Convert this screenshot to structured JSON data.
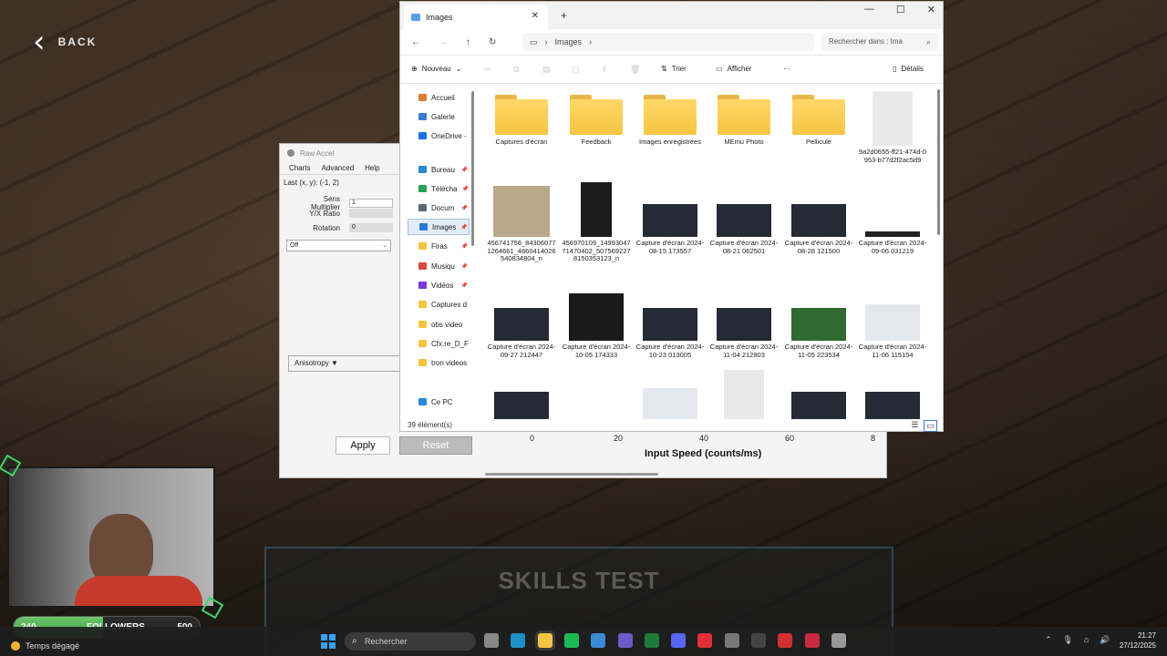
{
  "game": {
    "back_label": "BACK",
    "skills_test_label": "SKILLS TEST"
  },
  "rawaccel": {
    "title": "Raw Accel",
    "menu": [
      "Charts",
      "Advanced",
      "Help"
    ],
    "last_xy": "Last (x, y): (-1, 2)",
    "rows": [
      {
        "label": "Sens Multiplier",
        "value": "1"
      },
      {
        "label": "Y/X Ratio",
        "value": ""
      },
      {
        "label": "Rotation",
        "value": "0"
      }
    ],
    "mode_select": "Off",
    "anisotropy_label": "Anisotropy ▼",
    "apply_label": "Apply",
    "reset_label": "Reset",
    "axis_ticks": [
      "0",
      "20",
      "40",
      "60",
      "8"
    ],
    "x_axis_label": "Input Speed (counts/ms)"
  },
  "explorer": {
    "tab_title": "Images",
    "new_tab": "+",
    "window_controls": [
      "—",
      "☐",
      "✕"
    ],
    "breadcrumb": "Images",
    "search_placeholder": "Rechercher dans : Ima",
    "commands": {
      "new": "Nouveau",
      "sort": "Trier",
      "view": "Afficher",
      "more": "···",
      "details": "Détails"
    },
    "nav": [
      {
        "label": "Accueil",
        "color": "#e07b39",
        "pin": false
      },
      {
        "label": "Galerie",
        "color": "#3a7bd5",
        "pin": false
      },
      {
        "label": "OneDrive -",
        "color": "#1a73e8",
        "pin": false
      },
      {
        "label": "Bureau",
        "color": "#2a8ad6",
        "pin": true
      },
      {
        "label": "Télécha",
        "color": "#2aa05a",
        "pin": true
      },
      {
        "label": "Docum",
        "color": "#5a6a7a",
        "pin": true
      },
      {
        "label": "Images",
        "color": "#2a7ad6",
        "pin": true
      },
      {
        "label": "Firas",
        "color": "#f5c542",
        "pin": true
      },
      {
        "label": "Musiqu",
        "color": "#d84a3a",
        "pin": true
      },
      {
        "label": "Vidéos",
        "color": "#7a3ad8",
        "pin": true
      },
      {
        "label": "Captures d",
        "color": "#f5c542",
        "pin": false
      },
      {
        "label": "obs video",
        "color": "#f5c542",
        "pin": false
      },
      {
        "label": "Cfx.re_D_F",
        "color": "#f5c542",
        "pin": false
      },
      {
        "label": "tron videos",
        "color": "#f5c542",
        "pin": false
      },
      {
        "label": "Ce PC",
        "color": "#2a8ad6",
        "pin": false
      }
    ],
    "files": [
      {
        "name": "Captures d'écran",
        "kind": "folder"
      },
      {
        "name": "Feedback",
        "kind": "folder"
      },
      {
        "name": "Images enregistrées",
        "kind": "folder"
      },
      {
        "name": "MEmu Photo",
        "kind": "folder"
      },
      {
        "name": "Pellicule",
        "kind": "folder"
      },
      {
        "name": "9a2d0655-ff21-474d-0953-b77d2f2ac5d9",
        "kind": "doc"
      },
      {
        "name": "456741756_843060771264661_4860414026540834804_n",
        "kind": "photo"
      },
      {
        "name": "456970109_1499304771470402_5075692278150353123_n",
        "kind": "phone"
      },
      {
        "name": "Capture d'écran 2024-08-15 173557",
        "kind": "shot"
      },
      {
        "name": "Capture d'écran 2024-08-21 062501",
        "kind": "shot"
      },
      {
        "name": "Capture d'écran 2024-08-28 121500",
        "kind": "shot"
      },
      {
        "name": "Capture d'écran 2024-09-06 031219",
        "kind": "thin"
      },
      {
        "name": "Capture d'écran 2024-09-27 212447",
        "kind": "shot"
      },
      {
        "name": "Capture d'écran 2024-10-05 174333",
        "kind": "chart"
      },
      {
        "name": "Capture d'écran 2024-10-23 013005",
        "kind": "shot"
      },
      {
        "name": "Capture d'écran 2024-11-04 212903",
        "kind": "shot"
      },
      {
        "name": "Capture d'écran 2024-11-05 223534",
        "kind": "green"
      },
      {
        "name": "Capture d'écran 2024-11-06 115154",
        "kind": "light"
      },
      {
        "name": "",
        "kind": "shot"
      },
      {
        "name": "",
        "kind": "thin"
      },
      {
        "name": "",
        "kind": "light"
      },
      {
        "name": "",
        "kind": "doc"
      },
      {
        "name": "",
        "kind": "shot"
      },
      {
        "name": "",
        "kind": "shot"
      }
    ],
    "status": "39 élément(s)"
  },
  "stream": {
    "followers_current": "240",
    "followers_label": "FOLLOWERS",
    "followers_goal": "500",
    "followers_progress": 0.48
  },
  "taskbar": {
    "weather": "Temps dégagé",
    "search_placeholder": "Rechercher",
    "apps": [
      {
        "name": "task-view-icon",
        "color": "#888"
      },
      {
        "name": "edge-icon",
        "color": "#1e90c8"
      },
      {
        "name": "file-explorer-icon",
        "color": "#f5c542"
      },
      {
        "name": "spotify-icon",
        "color": "#1db954"
      },
      {
        "name": "store-icon",
        "color": "#3a8ad6"
      },
      {
        "name": "teams-icon",
        "color": "#6b5bc8"
      },
      {
        "name": "excel-icon",
        "color": "#1f7a3a"
      },
      {
        "name": "discord-icon",
        "color": "#5865f2"
      },
      {
        "name": "valorant-icon",
        "color": "#e0303a"
      },
      {
        "name": "steam-icon",
        "color": "#777"
      },
      {
        "name": "terminal-icon",
        "color": "#444"
      },
      {
        "name": "app-red-icon",
        "color": "#d03030"
      },
      {
        "name": "app-red2-icon",
        "color": "#c82840"
      },
      {
        "name": "app-gray-icon",
        "color": "#999"
      }
    ],
    "time": "21:27",
    "date": "27/12/2025"
  }
}
